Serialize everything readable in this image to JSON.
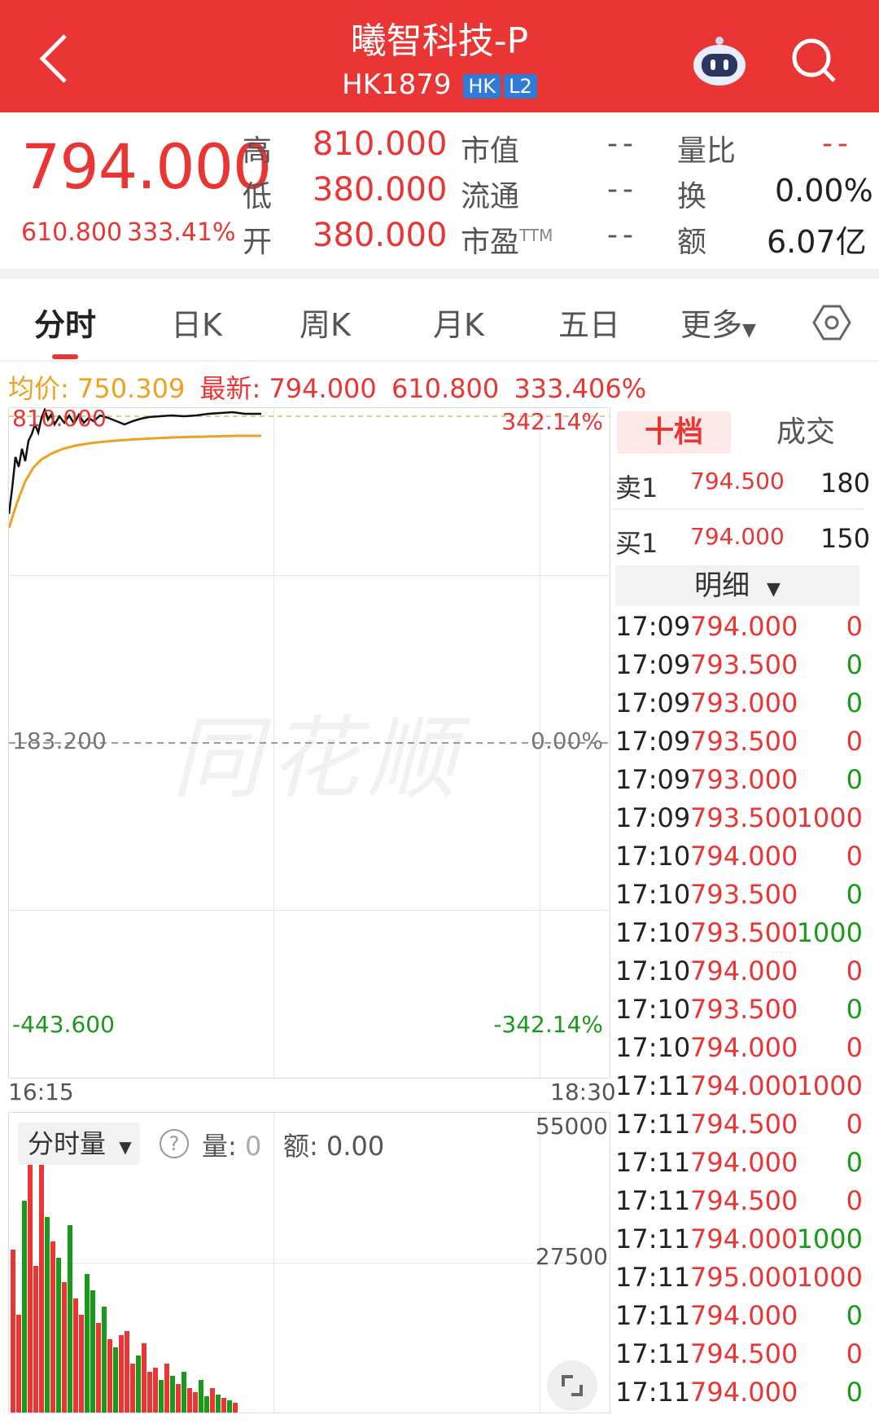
{
  "header": {
    "title": "曦智科技-P",
    "code": "HK1879",
    "tags": [
      "HK",
      "L2"
    ]
  },
  "quote": {
    "price": "794.000",
    "change": "610.800",
    "change_pct": "333.41%",
    "high_label": "高",
    "high": "810.000",
    "low_label": "低",
    "low": "380.000",
    "open_label": "开",
    "open": "380.000",
    "mktcap_label": "市值",
    "mktcap": "--",
    "float_label": "流通",
    "float": "--",
    "pe_label": "市盈",
    "pe_sup": "TTM",
    "pe": "--",
    "volratio_label": "量比",
    "volratio": "--",
    "turnover_label": "换",
    "turnover": "0.00%",
    "amount_label": "额",
    "amount": "6.07亿"
  },
  "tabs": [
    "分时",
    "日K",
    "周K",
    "月K",
    "五日",
    "更多"
  ],
  "legend": {
    "avg_label": "均价:",
    "avg": "750.309",
    "latest_label": "最新:",
    "latest": "794.000",
    "change": "610.800",
    "pct": "333.406%"
  },
  "chart": {
    "y_top": "810.000",
    "y_mid": "183.200",
    "y_bottom": "-443.600",
    "pct_top": "342.14%",
    "pct_mid": "0.00%",
    "pct_bottom": "-342.14%",
    "x_start": "16:15",
    "x_end": "18:30",
    "watermark": "同花顺"
  },
  "chart_data": {
    "type": "line",
    "series": [],
    "x": [
      "16:15",
      "18:30"
    ],
    "ylim": [
      -443.6,
      810.0
    ],
    "grid": true
  },
  "volume": {
    "dropdown": "分时量",
    "help": "?",
    "vol_label": "量:",
    "vol_value": "0",
    "amt_label": "额:",
    "amt_value": "0.00",
    "axis_top": "55000",
    "axis_mid": "27500"
  },
  "orderbook": {
    "tab_active": "十档",
    "tab_other": "成交",
    "sell_label": "卖1",
    "sell_price": "794.500",
    "sell_vol": "180",
    "buy_label": "买1",
    "buy_price": "794.000",
    "buy_vol": "150",
    "detail_label": "明细"
  },
  "trades": [
    {
      "time": "17:09",
      "price": "794.000",
      "vol": "0",
      "dir": "red"
    },
    {
      "time": "17:09",
      "price": "793.500",
      "vol": "0",
      "dir": "green"
    },
    {
      "time": "17:09",
      "price": "793.000",
      "vol": "0",
      "dir": "green"
    },
    {
      "time": "17:09",
      "price": "793.500",
      "vol": "0",
      "dir": "red"
    },
    {
      "time": "17:09",
      "price": "793.000",
      "vol": "0",
      "dir": "green"
    },
    {
      "time": "17:09",
      "price": "793.500",
      "vol": "1000",
      "dir": "red"
    },
    {
      "time": "17:10",
      "price": "794.000",
      "vol": "0",
      "dir": "red"
    },
    {
      "time": "17:10",
      "price": "793.500",
      "vol": "0",
      "dir": "green"
    },
    {
      "time": "17:10",
      "price": "793.500",
      "vol": "1000",
      "dir": "green"
    },
    {
      "time": "17:10",
      "price": "794.000",
      "vol": "0",
      "dir": "red"
    },
    {
      "time": "17:10",
      "price": "793.500",
      "vol": "0",
      "dir": "green"
    },
    {
      "time": "17:10",
      "price": "794.000",
      "vol": "0",
      "dir": "red"
    },
    {
      "time": "17:11",
      "price": "794.000",
      "vol": "1000",
      "dir": "red"
    },
    {
      "time": "17:11",
      "price": "794.500",
      "vol": "0",
      "dir": "red"
    },
    {
      "time": "17:11",
      "price": "794.000",
      "vol": "0",
      "dir": "green"
    },
    {
      "time": "17:11",
      "price": "794.500",
      "vol": "0",
      "dir": "red"
    },
    {
      "time": "17:11",
      "price": "794.000",
      "vol": "1000",
      "dir": "green"
    },
    {
      "time": "17:11",
      "price": "795.000",
      "vol": "1000",
      "dir": "red"
    },
    {
      "time": "17:11",
      "price": "794.000",
      "vol": "0",
      "dir": "green"
    },
    {
      "time": "17:11",
      "price": "794.500",
      "vol": "0",
      "dir": "red"
    },
    {
      "time": "17:11",
      "price": "794.000",
      "vol": "0",
      "dir": "green"
    }
  ],
  "colors": {
    "brand": "#e93534",
    "up": "#e93534",
    "down": "#1a9a1a",
    "avg_line": "#f0a020",
    "tag": "#2f7bd6"
  }
}
